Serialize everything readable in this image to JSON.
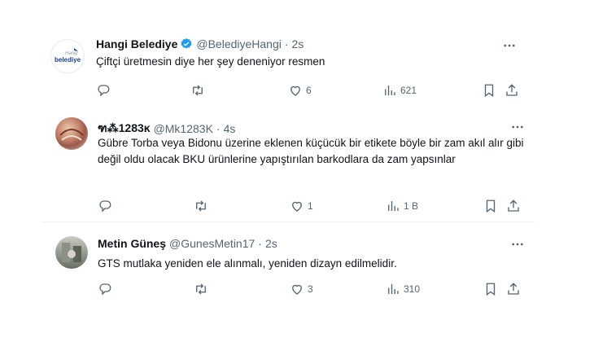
{
  "tweets": [
    {
      "name": "Hangi Belediye",
      "handle": "@BelediyeHangi",
      "dot": "·",
      "time": "2s",
      "verified": true,
      "avatar_logo_text": [
        "Hangi",
        "belediye"
      ],
      "text": "Çiftçi üretmesin diye her şey deneniyor resmen",
      "reply_count": "",
      "retweet_count": "",
      "like_count": "6",
      "view_count": "621"
    },
    {
      "name": "ฑ⁂1283ĸ",
      "handle": "@Mk1283K",
      "dot": "·",
      "time": "4s",
      "verified": false,
      "text": "Gübre Torba veya Bidonu üzerine eklenen küçücük bir etikete böyle bir zam akıl alır gibi değil oldu olacak BKU ürünlerine yapıştırılan barkodlara da zam yapsınlar",
      "reply_count": "",
      "retweet_count": "",
      "like_count": "1",
      "view_count": "1 B"
    },
    {
      "name": "Metin Güneş",
      "handle": "@GunesMetin17",
      "dot": "·",
      "time": "2s",
      "verified": false,
      "text": "GTS mutlaka yeniden ele alınmalı, yeniden dizayn edilmelidir.",
      "reply_count": "",
      "retweet_count": "",
      "like_count": "3",
      "view_count": "310"
    }
  ],
  "icons": {
    "reply": "reply-icon",
    "retweet": "retweet-icon",
    "like": "heart-icon",
    "views": "views-icon",
    "bookmark": "bookmark-icon",
    "share": "share-icon",
    "more": "more-icon",
    "verified": "verified-badge-icon"
  },
  "colors": {
    "text": "#0f1419",
    "muted": "#536471",
    "verified": "#1d9bf0",
    "divider": "#eff3f4"
  }
}
